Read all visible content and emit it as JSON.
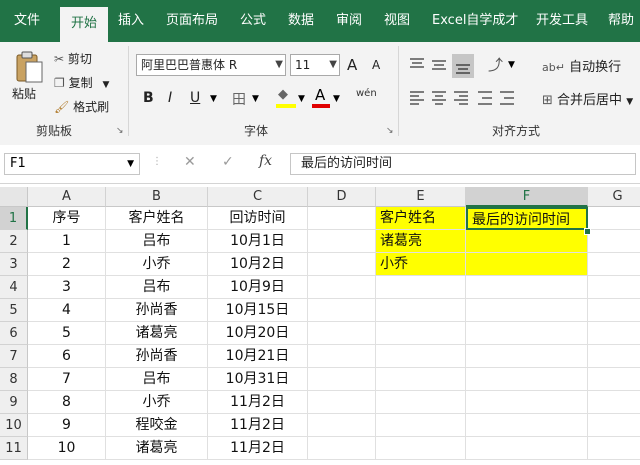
{
  "tabs": [
    "文件",
    "开始",
    "插入",
    "页面布局",
    "公式",
    "数据",
    "审阅",
    "视图",
    "Excel自学成才",
    "开发工具",
    "帮助"
  ],
  "active_tab": "开始",
  "clipboard": {
    "paste": "粘贴",
    "cut": "剪切",
    "copy": "复制",
    "format_painter": "格式刷",
    "group_label": "剪贴板"
  },
  "font": {
    "name": "阿里巴巴普惠体 R",
    "size": "11",
    "grow": "A",
    "shrink": "A",
    "bold": "B",
    "italic": "I",
    "underline": "U",
    "border": "田",
    "fill": "◆",
    "color": "A",
    "wen": "wén",
    "group_label": "字体"
  },
  "alignment": {
    "wrap_text": "自动换行",
    "merge_center": "合并后居中",
    "group_label": "对齐方式"
  },
  "formula_bar": {
    "name_box": "F1",
    "cancel": "✕",
    "enter": "✓",
    "fx": "fx",
    "content": "最后的访问时间"
  },
  "columns": [
    "A",
    "B",
    "C",
    "D",
    "E",
    "F",
    "G"
  ],
  "rows": [
    [
      "序号",
      "客户姓名",
      "回访时间",
      "",
      "客户姓名",
      "最后的访问时间",
      ""
    ],
    [
      "1",
      "吕布",
      "10月1日",
      "",
      "诸葛亮",
      "",
      ""
    ],
    [
      "2",
      "小乔",
      "10月2日",
      "",
      "小乔",
      "",
      ""
    ],
    [
      "3",
      "吕布",
      "10月9日",
      "",
      "",
      "",
      ""
    ],
    [
      "4",
      "孙尚香",
      "10月15日",
      "",
      "",
      "",
      ""
    ],
    [
      "5",
      "诸葛亮",
      "10月20日",
      "",
      "",
      "",
      ""
    ],
    [
      "6",
      "孙尚香",
      "10月21日",
      "",
      "",
      "",
      ""
    ],
    [
      "7",
      "吕布",
      "10月31日",
      "",
      "",
      "",
      ""
    ],
    [
      "8",
      "小乔",
      "11月2日",
      "",
      "",
      "",
      ""
    ],
    [
      "9",
      "程咬金",
      "11月2日",
      "",
      "",
      "",
      ""
    ],
    [
      "10",
      "诸葛亮",
      "11月2日",
      "",
      "",
      "",
      ""
    ]
  ],
  "row_numbers": [
    "1",
    "2",
    "3",
    "4",
    "5",
    "6",
    "7",
    "8",
    "9",
    "10",
    "11"
  ],
  "active_cell": "F1",
  "highlight_color": "#ffff00",
  "accent_color": "#217346"
}
